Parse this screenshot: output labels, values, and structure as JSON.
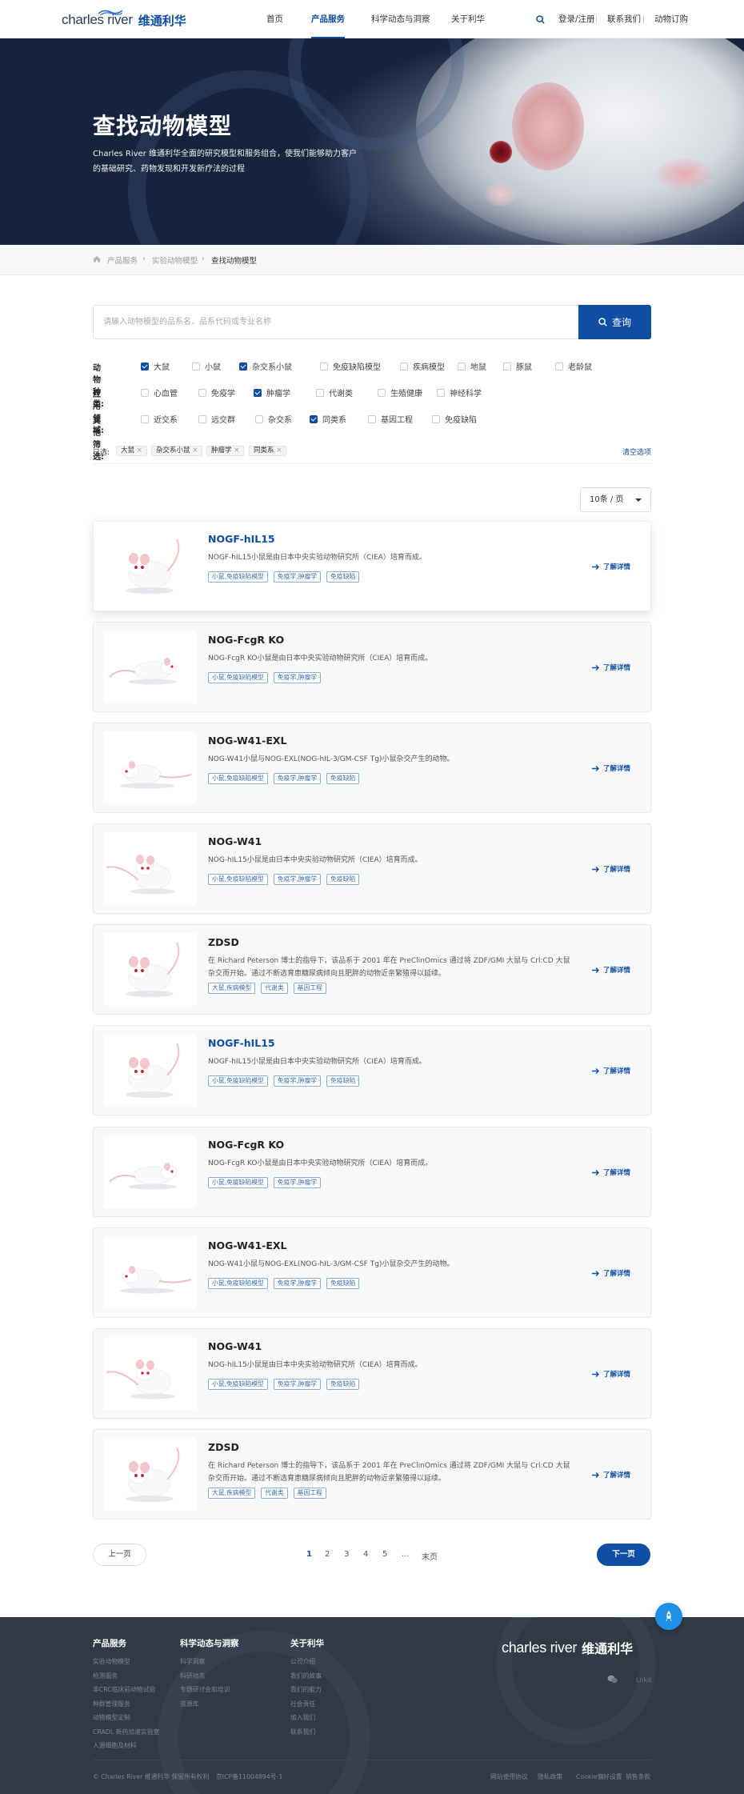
{
  "header": {
    "logo_en": "charles river",
    "logo_cn": "维通利华",
    "nav": [
      "首页",
      "产品服务",
      "科学动态与洞察",
      "关于利华"
    ],
    "right": [
      "登录/注册",
      "联系我们",
      "动物订购"
    ]
  },
  "hero": {
    "title": "查找动物模型",
    "subtitle": "Charles River 维通利华全面的研究模型和服务组合，使我们能够助力客户的基础研究、药物发现和开发新疗法的过程"
  },
  "breadcrumb": [
    "产品服务",
    "实验动物模型",
    "查找动物模型"
  ],
  "search": {
    "placeholder": "请输入动物模型的品系名、品系代码或专业名称",
    "button": "查询"
  },
  "filters": {
    "species": {
      "label": "动物种类:",
      "options": [
        {
          "text": "大鼠",
          "checked": true
        },
        {
          "text": "小鼠",
          "checked": false
        },
        {
          "text": "杂交系小鼠",
          "checked": true
        },
        {
          "text": "免疫缺陷模型",
          "checked": false
        },
        {
          "text": "疾病模型",
          "checked": false
        },
        {
          "text": "地鼠",
          "checked": false
        },
        {
          "text": "豚鼠",
          "checked": false
        },
        {
          "text": "老龄鼠",
          "checked": false
        }
      ]
    },
    "area": {
      "label": "应用领域:",
      "options": [
        {
          "text": "心血管",
          "checked": false
        },
        {
          "text": "免疫学",
          "checked": false
        },
        {
          "text": "肿瘤学",
          "checked": true
        },
        {
          "text": "代谢类",
          "checked": false
        },
        {
          "text": "生殖健康",
          "checked": false
        },
        {
          "text": "神经科学",
          "checked": false
        }
      ]
    },
    "other": {
      "label": "其他筛选:",
      "options": [
        {
          "text": "近交系",
          "checked": false
        },
        {
          "text": "远交群",
          "checked": false
        },
        {
          "text": "杂交系",
          "checked": false
        },
        {
          "text": "同类系",
          "checked": true
        },
        {
          "text": "基因工程",
          "checked": false
        },
        {
          "text": "免疫缺陷",
          "checked": false
        }
      ]
    }
  },
  "selected": {
    "label": "已选:",
    "tags": [
      "大鼠",
      "杂交系小鼠",
      "肿瘤学",
      "同类系"
    ],
    "clear": "清空选项"
  },
  "per_page": "10条 / 页",
  "cards": [
    {
      "title": "NOGF-hIL15",
      "desc": "NOGF-hIL15小鼠是由日本中央实验动物研究所（CIEA）培育而成。",
      "tags": [
        "小鼠,免疫缺陷模型",
        "免疫学,肿瘤学",
        "免疫缺陷"
      ],
      "more": "了解详情"
    },
    {
      "title": "NOG-FcgR KO",
      "desc": "NOG-FcgR KO小鼠是由日本中央实验动物研究所（CIEA）培育而成。",
      "tags": [
        "小鼠,免疫缺陷模型",
        "免疫学,肿瘤学"
      ],
      "more": "了解详情"
    },
    {
      "title": "NOG-W41-EXL",
      "desc": "NOG-W41小鼠与NOG-EXL(NOG-hIL-3/GM-CSF Tg)小鼠杂交产生的动物。",
      "tags": [
        "小鼠,免疫缺陷模型",
        "免疫学,肿瘤学",
        "免疫缺陷"
      ],
      "more": "了解详情"
    },
    {
      "title": "NOG-W41",
      "desc": "NOG-hIL15小鼠是由日本中央实验动物研究所（CIEA）培育而成。",
      "tags": [
        "小鼠,免疫缺陷模型",
        "免疫学,肿瘤学",
        "免疫缺陷"
      ],
      "more": "了解详情"
    },
    {
      "title": "ZDSD",
      "desc": "在 Richard Peterson 博士的指导下，该品系于 2001 年在 PreClinOmics 通过将 ZDF/GMI 大鼠与 Crl:CD 大鼠杂交而开始。通过不断选育患糖尿病倾向且肥胖的动物近亲繁殖得以延续。",
      "tags": [
        "大鼠,疾病模型",
        "代谢类",
        "基因工程"
      ],
      "more": "了解详情"
    },
    {
      "title": "NOGF-hIL15",
      "desc": "NOGF-hIL15小鼠是由日本中央实验动物研究所（CIEA）培育而成。",
      "tags": [
        "小鼠,免疫缺陷模型",
        "免疫学,肿瘤学",
        "免疫缺陷"
      ],
      "more": "了解详情"
    },
    {
      "title": "NOG-FcgR KO",
      "desc": "NOG-FcgR KO小鼠是由日本中央实验动物研究所（CIEA）培育而成。",
      "tags": [
        "小鼠,免疫缺陷模型",
        "免疫学,肿瘤学"
      ],
      "more": "了解详情"
    },
    {
      "title": "NOG-W41-EXL",
      "desc": "NOG-W41小鼠与NOG-EXL(NOG-hIL-3/GM-CSF Tg)小鼠杂交产生的动物。",
      "tags": [
        "小鼠,免疫缺陷模型",
        "免疫学,肿瘤学",
        "免疫缺陷"
      ],
      "more": "了解详情"
    },
    {
      "title": "NOG-W41",
      "desc": "NOG-hIL15小鼠是由日本中央实验动物研究所（CIEA）培育而成。",
      "tags": [
        "小鼠,免疫缺陷模型",
        "免疫学,肿瘤学",
        "免疫缺陷"
      ],
      "more": "了解详情"
    },
    {
      "title": "ZDSD",
      "desc": "在 Richard Peterson 博士的指导下，该品系于 2001 年在 PreClinOmics 通过将 ZDF/GMI 大鼠与 Crl:CD 大鼠杂交而开始。通过不断选育患糖尿病倾向且肥胖的动物近亲繁殖得以延续。",
      "tags": [
        "大鼠,疾病模型",
        "代谢类",
        "基因工程"
      ],
      "more": "了解详情"
    }
  ],
  "pager": {
    "prev": "上一页",
    "pages": [
      "1",
      "2",
      "3",
      "4",
      "5",
      "...",
      "末页"
    ],
    "current": "1",
    "next": "下一页"
  },
  "footer": {
    "cols": [
      {
        "title": "产品服务",
        "links": [
          "实验动物模型",
          "检测服务",
          "非CRC临床前动物试验",
          "种群管理服务",
          "动物模型定制",
          "CRADL 新药加速实验室",
          "人源细胞及材料"
        ]
      },
      {
        "title": "科学动态与洞察",
        "links": [
          "科学洞察",
          "科研动态",
          "专题研讨会和培训",
          "资源库"
        ]
      },
      {
        "title": "关于利华",
        "links": [
          "公司介绍",
          "我们的故事",
          "我们的能力",
          "社会责任",
          "加入我们",
          "联系我们"
        ]
      }
    ],
    "logo_en": "charles river",
    "logo_cn": "维通利华",
    "copyright": "© Charles River 维通利华 保留所有权利",
    "icp": "京ICP备11004894号-1",
    "legal": [
      "网站使用协议",
      "隐私政策",
      "Cookie偏好设置",
      "销售条款"
    ]
  },
  "colors": {
    "brand": "#0f4ea3",
    "footer": "#323a45",
    "totop": "#1e90e6"
  }
}
